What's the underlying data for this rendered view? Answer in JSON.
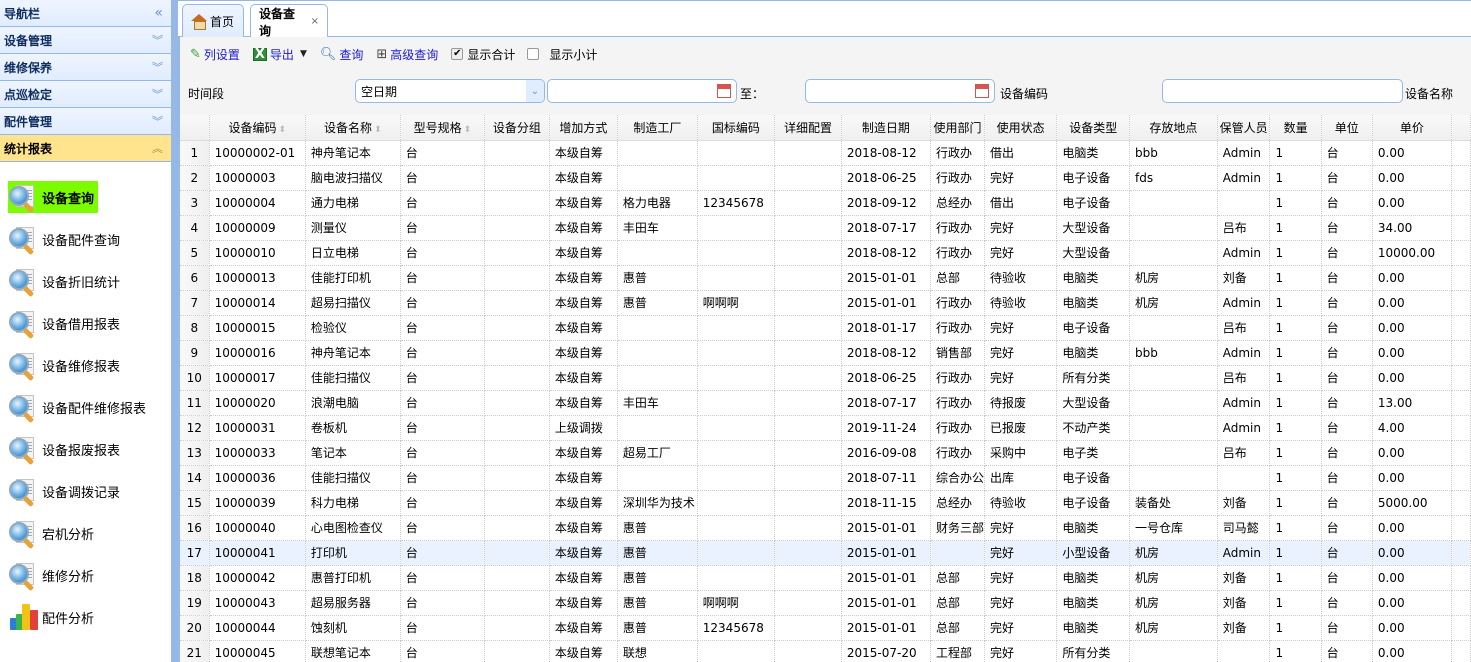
{
  "sidebar": {
    "title": "导航栏",
    "collapse_icon": "double-chevron-left-icon",
    "sections": [
      {
        "label": "设备管理",
        "expanded": false
      },
      {
        "label": "维修保养",
        "expanded": false
      },
      {
        "label": "点巡检定",
        "expanded": false
      },
      {
        "label": "配件管理",
        "expanded": false
      },
      {
        "label": "统计报表",
        "expanded": true
      }
    ],
    "items": [
      {
        "label": "设备查询",
        "icon": "magnifier-document-icon",
        "active": true
      },
      {
        "label": "设备配件查询",
        "icon": "magnifier-document-icon"
      },
      {
        "label": "设备折旧统计",
        "icon": "magnifier-document-icon"
      },
      {
        "label": "设备借用报表",
        "icon": "magnifier-document-icon"
      },
      {
        "label": "设备维修报表",
        "icon": "magnifier-document-icon"
      },
      {
        "label": "设备配件维修报表",
        "icon": "magnifier-document-icon"
      },
      {
        "label": "设备报废报表",
        "icon": "magnifier-document-icon"
      },
      {
        "label": "设备调拨记录",
        "icon": "magnifier-document-icon"
      },
      {
        "label": "宕机分析",
        "icon": "magnifier-document-icon"
      },
      {
        "label": "维修分析",
        "icon": "magnifier-document-icon"
      },
      {
        "label": "配件分析",
        "icon": "bar-chart-icon"
      }
    ]
  },
  "tabs": [
    {
      "label": "首页",
      "icon": "home-icon"
    },
    {
      "label": "设备查询",
      "closable": true,
      "close_glyph": "×"
    }
  ],
  "toolbar": {
    "column_settings": "列设置",
    "export": "导出",
    "query": "查询",
    "advanced_query": "高级查询",
    "show_total": {
      "label": "显示合计",
      "checked": true
    },
    "show_subtotal": {
      "label": "显示小计",
      "checked": false
    }
  },
  "filter": {
    "time_label": "时间段",
    "date_type_value": "空日期",
    "start_date": "",
    "to_label": "至：",
    "end_date": "",
    "code_label": "设备编码",
    "code_value": "",
    "name_label": "设备名称"
  },
  "grid": {
    "columns": [
      "设备编码",
      "设备名称",
      "型号规格",
      "设备分组",
      "增加方式",
      "制造工厂",
      "国标编码",
      "详细配置",
      "制造日期",
      "使用部门",
      "使用状态",
      "设备类型",
      "存放地点",
      "保管人员",
      "数量",
      "单位",
      "单价"
    ],
    "sortable": [
      true,
      true,
      true,
      false,
      false,
      false,
      false,
      false,
      false,
      false,
      false,
      false,
      false,
      false,
      false,
      false,
      false
    ],
    "selected_row": 17,
    "rows": [
      [
        "1",
        "10000002-01",
        "神舟笔记本",
        "台",
        "",
        "本级自筹",
        "",
        "",
        "",
        "2018-08-12",
        "行政办",
        "借出",
        "电脑类",
        "bbb",
        "Admin",
        "1",
        "台",
        "0.00"
      ],
      [
        "2",
        "10000003",
        "脑电波扫描仪",
        "台",
        "",
        "本级自筹",
        "",
        "",
        "",
        "2018-06-25",
        "行政办",
        "完好",
        "电子设备",
        "fds",
        "Admin",
        "1",
        "台",
        "0.00"
      ],
      [
        "3",
        "10000004",
        "通力电梯",
        "台",
        "",
        "本级自筹",
        "格力电器",
        "12345678",
        "",
        "2018-09-12",
        "总经办",
        "借出",
        "电子设备",
        "",
        "",
        "1",
        "台",
        "0.00"
      ],
      [
        "4",
        "10000009",
        "测量仪",
        "台",
        "",
        "本级自筹",
        "丰田车",
        "",
        "",
        "2018-07-17",
        "行政办",
        "完好",
        "大型设备",
        "",
        "吕布",
        "1",
        "台",
        "34.00"
      ],
      [
        "5",
        "10000010",
        "日立电梯",
        "台",
        "",
        "本级自筹",
        "",
        "",
        "",
        "2018-08-12",
        "行政办",
        "完好",
        "大型设备",
        "",
        "Admin",
        "1",
        "台",
        "10000.00"
      ],
      [
        "6",
        "10000013",
        "佳能打印机",
        "台",
        "",
        "本级自筹",
        "惠普",
        "",
        "",
        "2015-01-01",
        "总部",
        "待验收",
        "电脑类",
        "机房",
        "刘备",
        "1",
        "台",
        "0.00"
      ],
      [
        "7",
        "10000014",
        "超易扫描仪",
        "台",
        "",
        "本级自筹",
        "惠普",
        "啊啊啊",
        "",
        "2015-01-01",
        "行政办",
        "待验收",
        "电脑类",
        "机房",
        "Admin",
        "1",
        "台",
        "0.00"
      ],
      [
        "8",
        "10000015",
        "检验仪",
        "台",
        "",
        "本级自筹",
        "",
        "",
        "",
        "2018-01-17",
        "行政办",
        "完好",
        "电子设备",
        "",
        "吕布",
        "1",
        "台",
        "0.00"
      ],
      [
        "9",
        "10000016",
        "神舟笔记本",
        "台",
        "",
        "本级自筹",
        "",
        "",
        "",
        "2018-08-12",
        "销售部",
        "完好",
        "电脑类",
        "bbb",
        "Admin",
        "1",
        "台",
        "0.00"
      ],
      [
        "10",
        "10000017",
        "佳能扫描仪",
        "台",
        "",
        "本级自筹",
        "",
        "",
        "",
        "2018-06-25",
        "行政办",
        "完好",
        "所有分类",
        "",
        "吕布",
        "1",
        "台",
        "0.00"
      ],
      [
        "11",
        "10000020",
        "浪潮电脑",
        "台",
        "",
        "本级自筹",
        "丰田车",
        "",
        "",
        "2018-07-17",
        "行政办",
        "待报废",
        "大型设备",
        "",
        "Admin",
        "1",
        "台",
        "13.00"
      ],
      [
        "12",
        "10000031",
        "卷板机",
        "台",
        "",
        "上级调拨",
        "",
        "",
        "",
        "2019-11-24",
        "行政办",
        "已报废",
        "不动产类",
        "",
        "Admin",
        "1",
        "台",
        "4.00"
      ],
      [
        "13",
        "10000033",
        "笔记本",
        "台",
        "",
        "本级自筹",
        "超易工厂",
        "",
        "",
        "2016-09-08",
        "行政办",
        "采购中",
        "电子类",
        "",
        "吕布",
        "1",
        "台",
        "0.00"
      ],
      [
        "14",
        "10000036",
        "佳能扫描仪",
        "台",
        "",
        "本级自筹",
        "",
        "",
        "",
        "2018-07-11",
        "综合办公",
        "出库",
        "电子设备",
        "",
        "",
        "1",
        "台",
        "0.00"
      ],
      [
        "15",
        "10000039",
        "科力电梯",
        "台",
        "",
        "本级自筹",
        "深圳华为技术",
        "",
        "",
        "2018-11-15",
        "总经办",
        "待验收",
        "电子设备",
        "装备处",
        "刘备",
        "1",
        "台",
        "5000.00"
      ],
      [
        "16",
        "10000040",
        "心电图检查仪",
        "台",
        "",
        "本级自筹",
        "惠普",
        "",
        "",
        "2015-01-01",
        "财务三部",
        "完好",
        "电脑类",
        "一号仓库",
        "司马懿",
        "1",
        "台",
        "0.00"
      ],
      [
        "17",
        "10000041",
        "打印机",
        "台",
        "",
        "本级自筹",
        "惠普",
        "",
        "",
        "2015-01-01",
        "",
        "完好",
        "小型设备",
        "机房",
        "Admin",
        "1",
        "台",
        "0.00"
      ],
      [
        "18",
        "10000042",
        "惠普打印机",
        "台",
        "",
        "本级自筹",
        "惠普",
        "",
        "",
        "2015-01-01",
        "总部",
        "完好",
        "电脑类",
        "机房",
        "刘备",
        "1",
        "台",
        "0.00"
      ],
      [
        "19",
        "10000043",
        "超易服务器",
        "台",
        "",
        "本级自筹",
        "惠普",
        "啊啊啊",
        "",
        "2015-01-01",
        "总部",
        "完好",
        "电脑类",
        "机房",
        "刘备",
        "1",
        "台",
        "0.00"
      ],
      [
        "20",
        "10000044",
        "蚀刻机",
        "台",
        "",
        "本级自筹",
        "惠普",
        "12345678",
        "",
        "2015-01-01",
        "总部",
        "完好",
        "电脑类",
        "机房",
        "刘备",
        "1",
        "台",
        "0.00"
      ],
      [
        "21",
        "10000045",
        "联想笔记本",
        "台",
        "",
        "本级自筹",
        "联想",
        "",
        "",
        "2015-07-20",
        "工程部",
        "完好",
        "所有分类",
        "",
        "",
        "1",
        "台",
        "0.00"
      ]
    ]
  }
}
